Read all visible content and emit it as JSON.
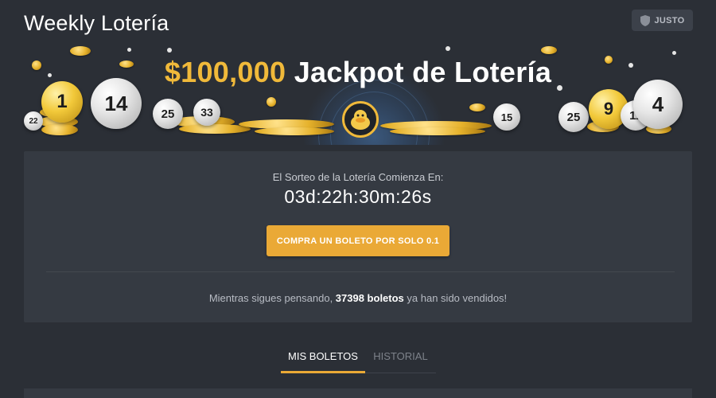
{
  "header": {
    "title": "Weekly Lotería",
    "fair_label": "JUSTO"
  },
  "banner": {
    "jackpot_amount": "$100,000",
    "jackpot_text": "Jackpot de Lotería",
    "balls": [
      "22",
      "1",
      "14",
      "25",
      "33",
      "15",
      "25",
      "9",
      "11",
      "4"
    ]
  },
  "lottery": {
    "countdown_label": "El Sorteo de la Lotería Comienza En:",
    "countdown_value": "03d:22h:30m:26s",
    "buy_button_label": "COMPRA UN BOLETO POR SOLO 0.1",
    "sold_prefix": "Mientras sigues pensando, ",
    "sold_count": "37398 boletos",
    "sold_suffix": " ya han sido vendidos!"
  },
  "tabs": [
    {
      "label": "MIS BOLETOS",
      "active": true
    },
    {
      "label": "HISTORIAL",
      "active": false
    }
  ],
  "colors": {
    "background": "#2b2f36",
    "panel": "#353a42",
    "accent": "#eaa936",
    "jackpot": "#f0b93a"
  }
}
